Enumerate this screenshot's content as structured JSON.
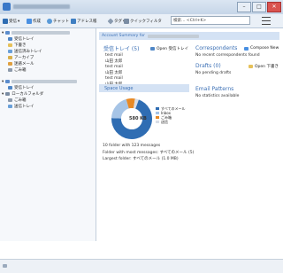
{
  "toolbar": {
    "get_mail": "受信",
    "compose": "作成",
    "chat": "チャット",
    "address_book": "アドレス帳",
    "tag": "タグ",
    "quick_filter": "クイックフィルタ",
    "search_placeholder": "検索… <Ctrl+K>"
  },
  "sidebar": {
    "folders1": [
      "受信トレイ",
      "下書き",
      "送信済みトレイ",
      "アーカイブ",
      "迷惑メール",
      "ごみ箱"
    ],
    "folders2": [
      "受信トレイ",
      "ローカルフォルダ",
      "ごみ箱",
      "送信トレイ"
    ]
  },
  "main": {
    "summary_header": "Account Summary for",
    "inbox": {
      "title": "受信トレイ (5)",
      "open_label": "Open 受信トレイ",
      "messages": [
        [
          "test mail",
          "山田 太郎"
        ],
        [
          "test mail",
          "山田 太郎"
        ],
        [
          "test mail",
          "山田 太郎"
        ]
      ]
    },
    "correspondents": {
      "title": "Correspondents",
      "compose_label": "Compose New",
      "empty": "No recent correspondents found"
    },
    "drafts": {
      "title": "Drafts (0)",
      "open_label": "Open 下書き",
      "empty": "No pending drafts"
    },
    "space": {
      "title": "Space Usage",
      "center": "580 KB",
      "legend": [
        "すべてのメール",
        "Inbox",
        "ごみ箱",
        "送信"
      ],
      "info": [
        "10 folder with 123 messages",
        "Folder with most messages: すべてのメール (5)",
        "Largest folder: すべてのメール (1.0 MB)"
      ]
    },
    "email_patterns": {
      "title": "Email Patterns",
      "empty": "No statistics available"
    }
  },
  "chart_data": {
    "type": "pie",
    "categories": [
      "すべてのメール",
      "Inbox",
      "ごみ箱",
      "送信"
    ],
    "values": [
      70,
      20,
      7,
      3
    ],
    "colors": [
      "#2f6db3",
      "#a6c4e6",
      "#e88a26",
      "#d8dde6"
    ]
  }
}
